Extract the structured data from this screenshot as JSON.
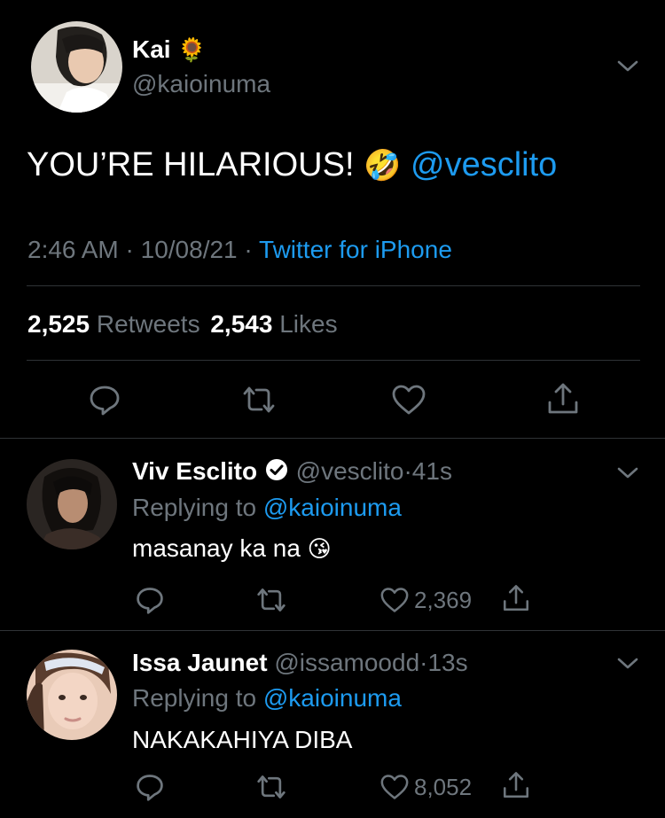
{
  "main_tweet": {
    "name": "Kai",
    "name_emoji": "🌻",
    "handle": "@kaioinuma",
    "text": "YOU’RE HILARIOUS!",
    "emoji": "🤣",
    "mention": "@vesclito",
    "time": "2:46 AM",
    "sep1": "·",
    "date": "10/08/21",
    "sep2": "·",
    "source": "Twitter for iPhone",
    "retweets_count": "2,525",
    "retweets_label": "Retweets",
    "likes_count": "2,543",
    "likes_label": "Likes"
  },
  "replies": [
    {
      "name": "Viv Esclito",
      "handle": "@vesclito",
      "dot": "·",
      "time": "41s",
      "replying_prefix": "Replying to",
      "replying_to": "@kaioinuma",
      "text": "masanay ka na",
      "emoji": "😘",
      "likes": "2,369"
    },
    {
      "name": "Issa Jaunet",
      "handle": "@issamoodd",
      "dot": "·",
      "time": "13s",
      "replying_prefix": "Replying to",
      "replying_to": "@kaioinuma",
      "text": "NAKAKAHIYA DIBA",
      "likes": "8,052"
    }
  ],
  "colors": {
    "background": "#000000",
    "text": "#ffffff",
    "secondary": "#6e767d",
    "link": "#1d9bf0",
    "divider": "#2f3336"
  },
  "icons": [
    "chevron-down-icon",
    "reply-icon",
    "retweet-icon",
    "like-icon",
    "share-icon",
    "verified-badge-icon"
  ]
}
